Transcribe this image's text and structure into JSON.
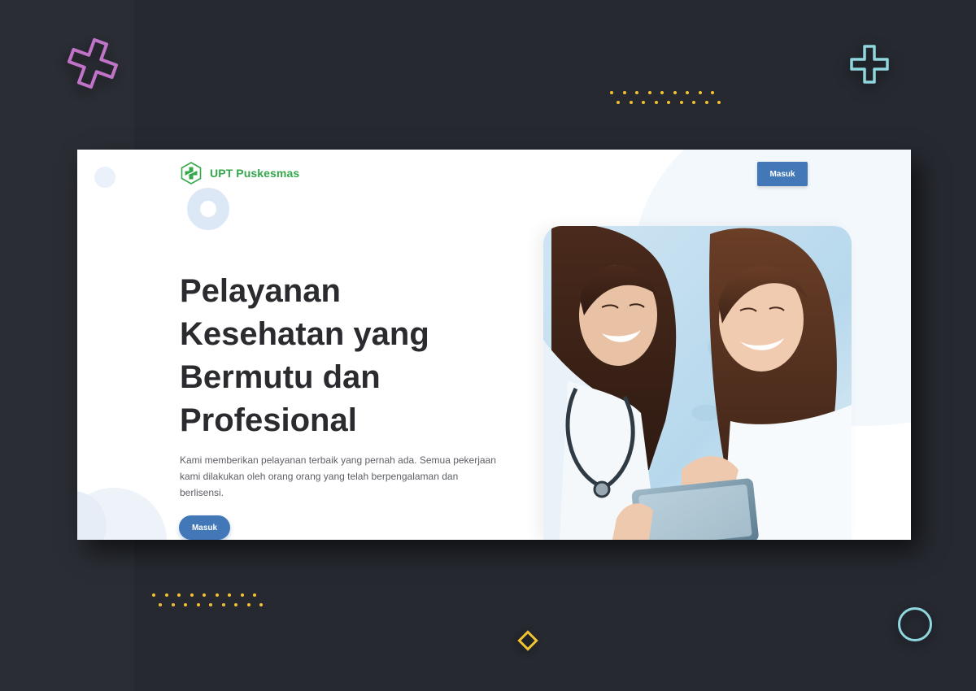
{
  "site": {
    "brand_name": "UPT Puskesmas",
    "logo_icon": "health-cross-logo-icon",
    "brand_color": "#34a84a"
  },
  "nav": {
    "login_label": "Masuk"
  },
  "hero": {
    "title": "Pelayanan Kesehatan yang Bermutu dan Profesional",
    "description": "Kami memberikan pelayanan terbaik yang pernah ada. Semua pekerjaan kami dilakukan oleh orang orang yang telah berpengalaman dan berlisensi.",
    "cta_label": "Masuk",
    "image": "doctors-with-tablet-photo"
  },
  "colors": {
    "accent": "#4277b8",
    "background": "#2a2d34",
    "decor_yellow": "#f2c230",
    "decor_pink": "#c173c8",
    "decor_cyan": "#8fd6de"
  }
}
